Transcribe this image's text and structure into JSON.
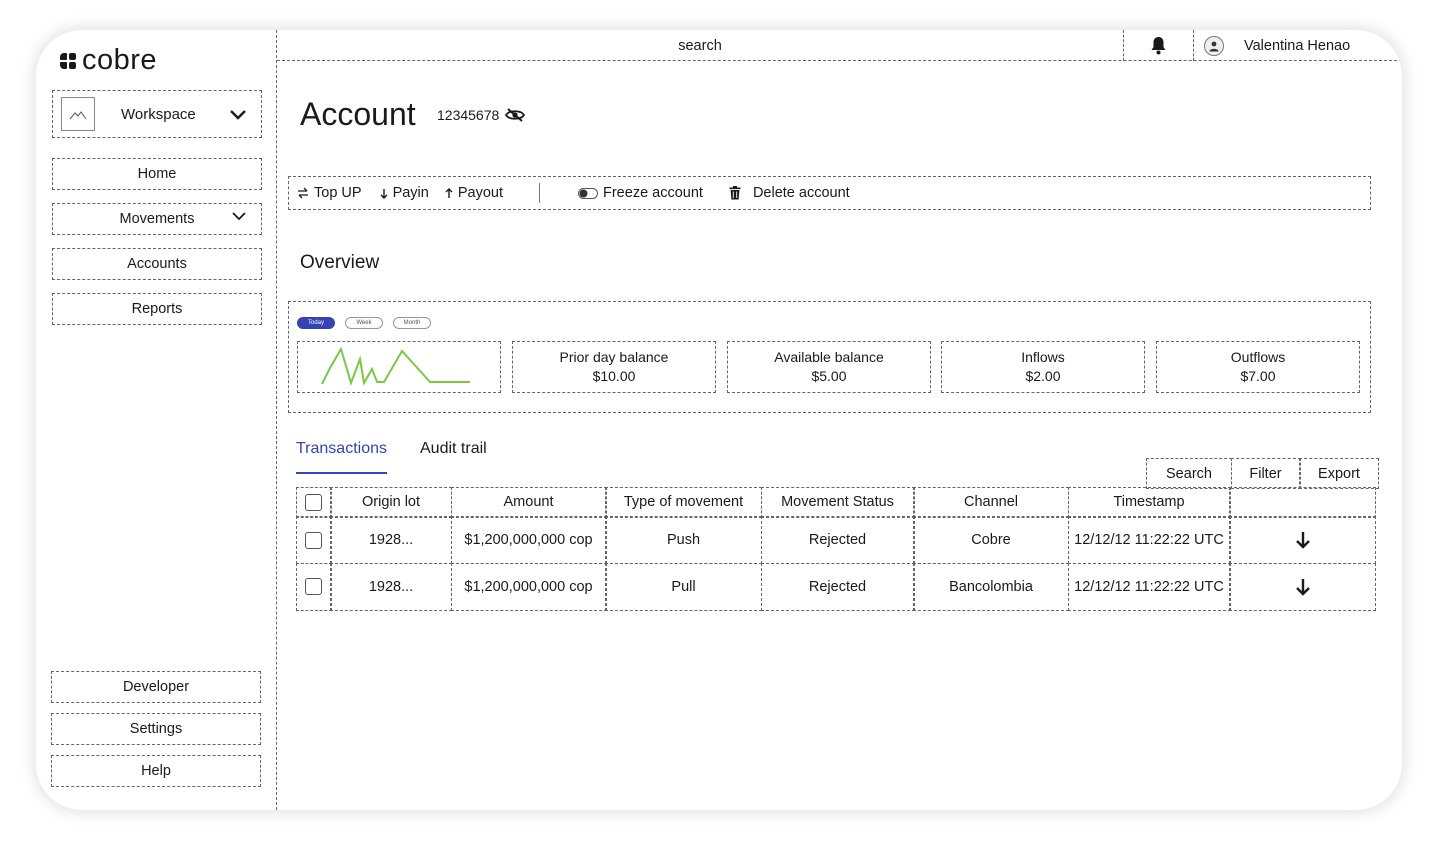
{
  "brand": {
    "logo_text": "cobre"
  },
  "sidebar": {
    "workspace_label": "Workspace",
    "nav": [
      {
        "label": "Home"
      },
      {
        "label": "Movements"
      },
      {
        "label": "Accounts"
      },
      {
        "label": "Reports"
      }
    ],
    "bottom": [
      {
        "label": "Developer"
      },
      {
        "label": "Settings"
      },
      {
        "label": "Help"
      }
    ]
  },
  "topbar": {
    "search_label": "search",
    "user_name": "Valentina Henao"
  },
  "page": {
    "title": "Account",
    "account_number": "12345678"
  },
  "actions": {
    "top_up": "Top UP",
    "payin": "Payin",
    "payout": "Payout",
    "freeze": "Freeze account",
    "delete": "Delete account"
  },
  "overview": {
    "heading": "Overview",
    "ranges": [
      "Today",
      "Week",
      "Month"
    ],
    "active_range": "Today",
    "spark_color": "#7ac943",
    "stats": [
      {
        "label": "Prior day balance",
        "value": "$10.00"
      },
      {
        "label": "Available balance",
        "value": "$5.00"
      },
      {
        "label": "Inflows",
        "value": "$2.00"
      },
      {
        "label": "Outflows",
        "value": "$7.00"
      }
    ]
  },
  "tabs": [
    "Transactions",
    "Audit trail"
  ],
  "table_tools": [
    "Search",
    "Filter",
    "Export"
  ],
  "table": {
    "columns": [
      "Origin lot",
      "Amount",
      "Type of movement",
      "Movement Status",
      "Channel",
      "Timestamp"
    ],
    "rows": [
      [
        "1928...",
        "$1,200,000,000 cop",
        "Push",
        "Rejected",
        "Cobre",
        "12/12/12 11:22:22 UTC"
      ],
      [
        "1928...",
        "$1,200,000,000 cop",
        "Pull",
        "Rejected",
        "Bancolombia",
        "12/12/12 11:22:22 UTC"
      ]
    ]
  },
  "colors": {
    "accent": "#3643b4",
    "spark": "#7ac943"
  }
}
